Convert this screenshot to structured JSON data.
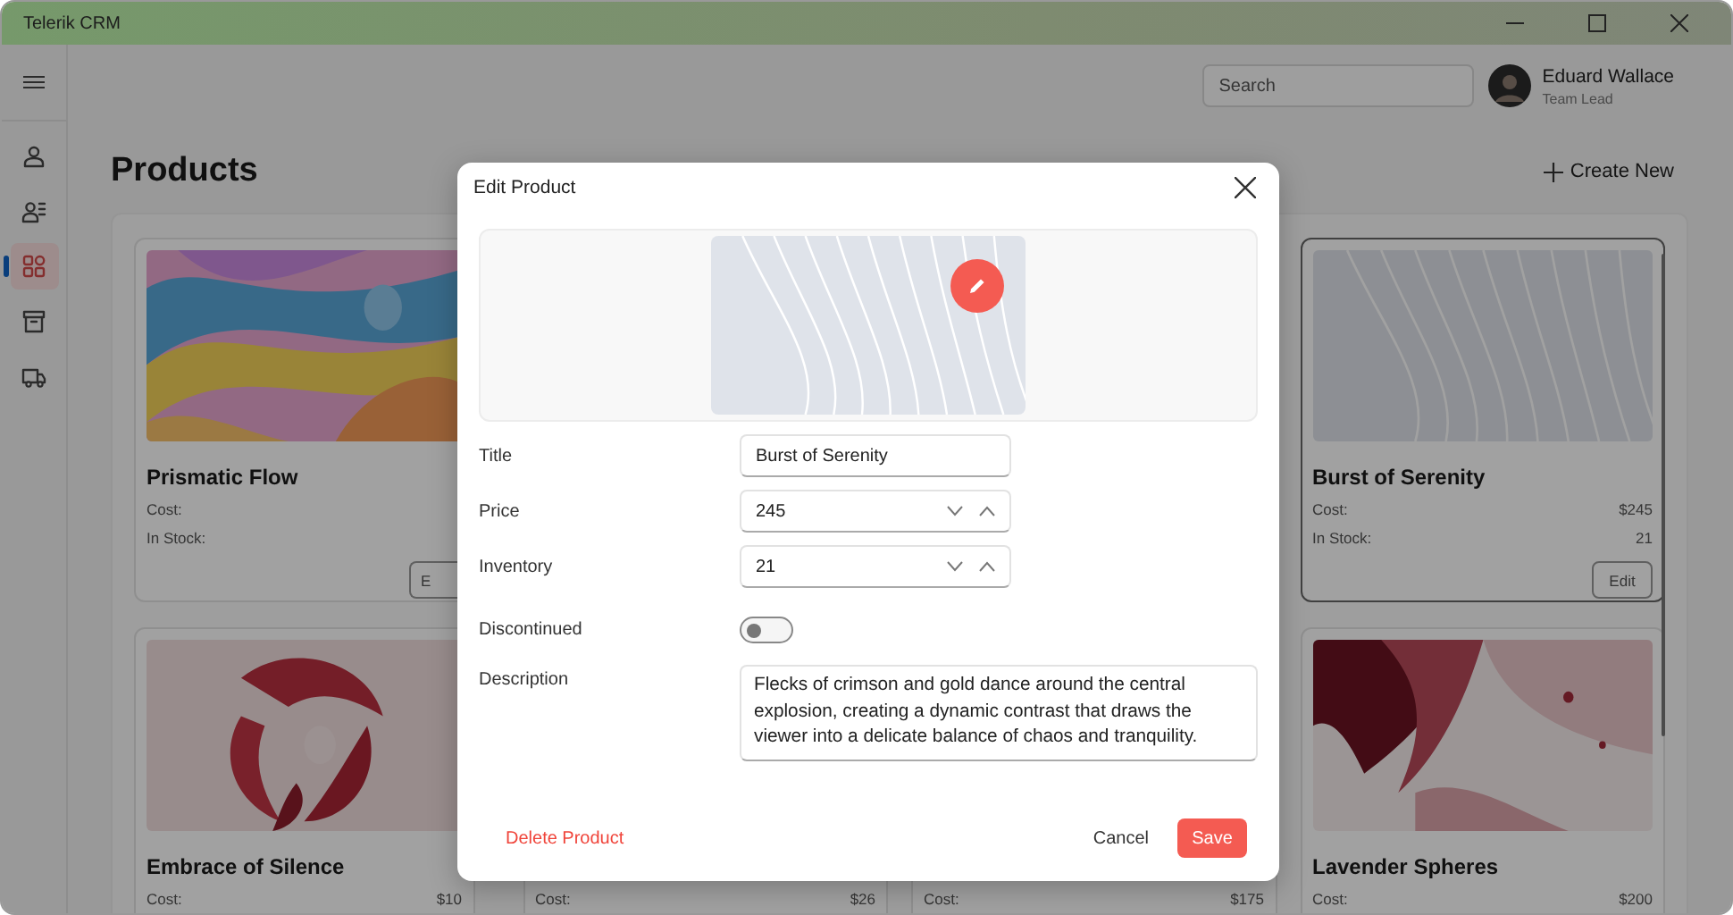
{
  "window": {
    "title": "Telerik CRM"
  },
  "sidebar": {
    "items": [
      {
        "kind": "contacts",
        "selected": false
      },
      {
        "kind": "team",
        "selected": false
      },
      {
        "kind": "products",
        "selected": true
      },
      {
        "kind": "archive",
        "selected": false
      },
      {
        "kind": "shipping",
        "selected": false
      }
    ]
  },
  "header": {
    "search": {
      "placeholder": "Search"
    },
    "user": {
      "name": "Eduard Wallace",
      "role": "Team Lead"
    }
  },
  "page": {
    "title": "Products",
    "create_button": "Create New"
  },
  "products": [
    {
      "title": "Prismatic Flow",
      "cost_label": "Cost:",
      "stock_label": "In Stock:",
      "edit_button": "E",
      "selected": false
    },
    {
      "title": "Burst of Serenity",
      "cost_label": "Cost:",
      "cost": "$245",
      "stock_label": "In Stock:",
      "stock": "21",
      "edit_button": "Edit",
      "selected": true
    },
    {
      "title": "Embrace of Silence",
      "cost_label": "Cost:",
      "cost": "$10",
      "selected": false
    },
    {
      "cost_label": "Cost:",
      "cost": "$26",
      "selected": false
    },
    {
      "cost_label": "Cost:",
      "cost": "$175",
      "selected": false
    },
    {
      "title": "Lavender Spheres",
      "cost_label": "Cost:",
      "cost": "$200",
      "selected": false
    }
  ],
  "dialog": {
    "title": "Edit Product",
    "fields": [
      {
        "kind": "text",
        "label": "Title",
        "value": "Burst of Serenity"
      },
      {
        "kind": "number",
        "label": "Price",
        "value": "245"
      },
      {
        "kind": "number",
        "label": "Inventory",
        "value": "21"
      },
      {
        "kind": "switch",
        "label": "Discontinued",
        "on": false
      },
      {
        "kind": "textarea",
        "label": "Description",
        "value": "Flecks of crimson and gold dance around the central explosion, creating a dynamic contrast that draws the viewer into a delicate balance of chaos and tranquility."
      }
    ],
    "delete_button": "Delete Product",
    "cancel_button": "Cancel",
    "save_button": "Save"
  }
}
